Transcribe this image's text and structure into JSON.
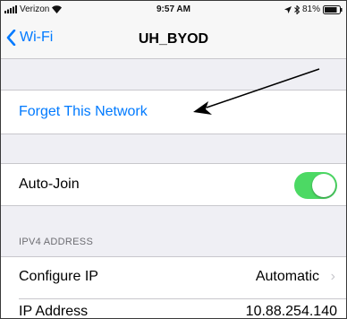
{
  "status_bar": {
    "carrier": "Verizon",
    "time": "9:57 AM",
    "battery": "81%",
    "icons": [
      "signal-bars-icon",
      "wifi-icon",
      "location-arrow-icon",
      "bluetooth-icon",
      "battery-icon"
    ]
  },
  "nav": {
    "back_label": "Wi-Fi",
    "title": "UH_BYOD"
  },
  "forget": {
    "label": "Forget This Network"
  },
  "auto_join": {
    "label": "Auto-Join",
    "enabled": true
  },
  "ipv4": {
    "header": "IPV4 ADDRESS",
    "configure_label": "Configure IP",
    "configure_value": "Automatic",
    "ip_label": "IP Address",
    "ip_value": "10.88.254.140"
  },
  "colors": {
    "accent": "#007aff",
    "toggle_on": "#4cd964",
    "grouped_background": "#efeff4"
  }
}
